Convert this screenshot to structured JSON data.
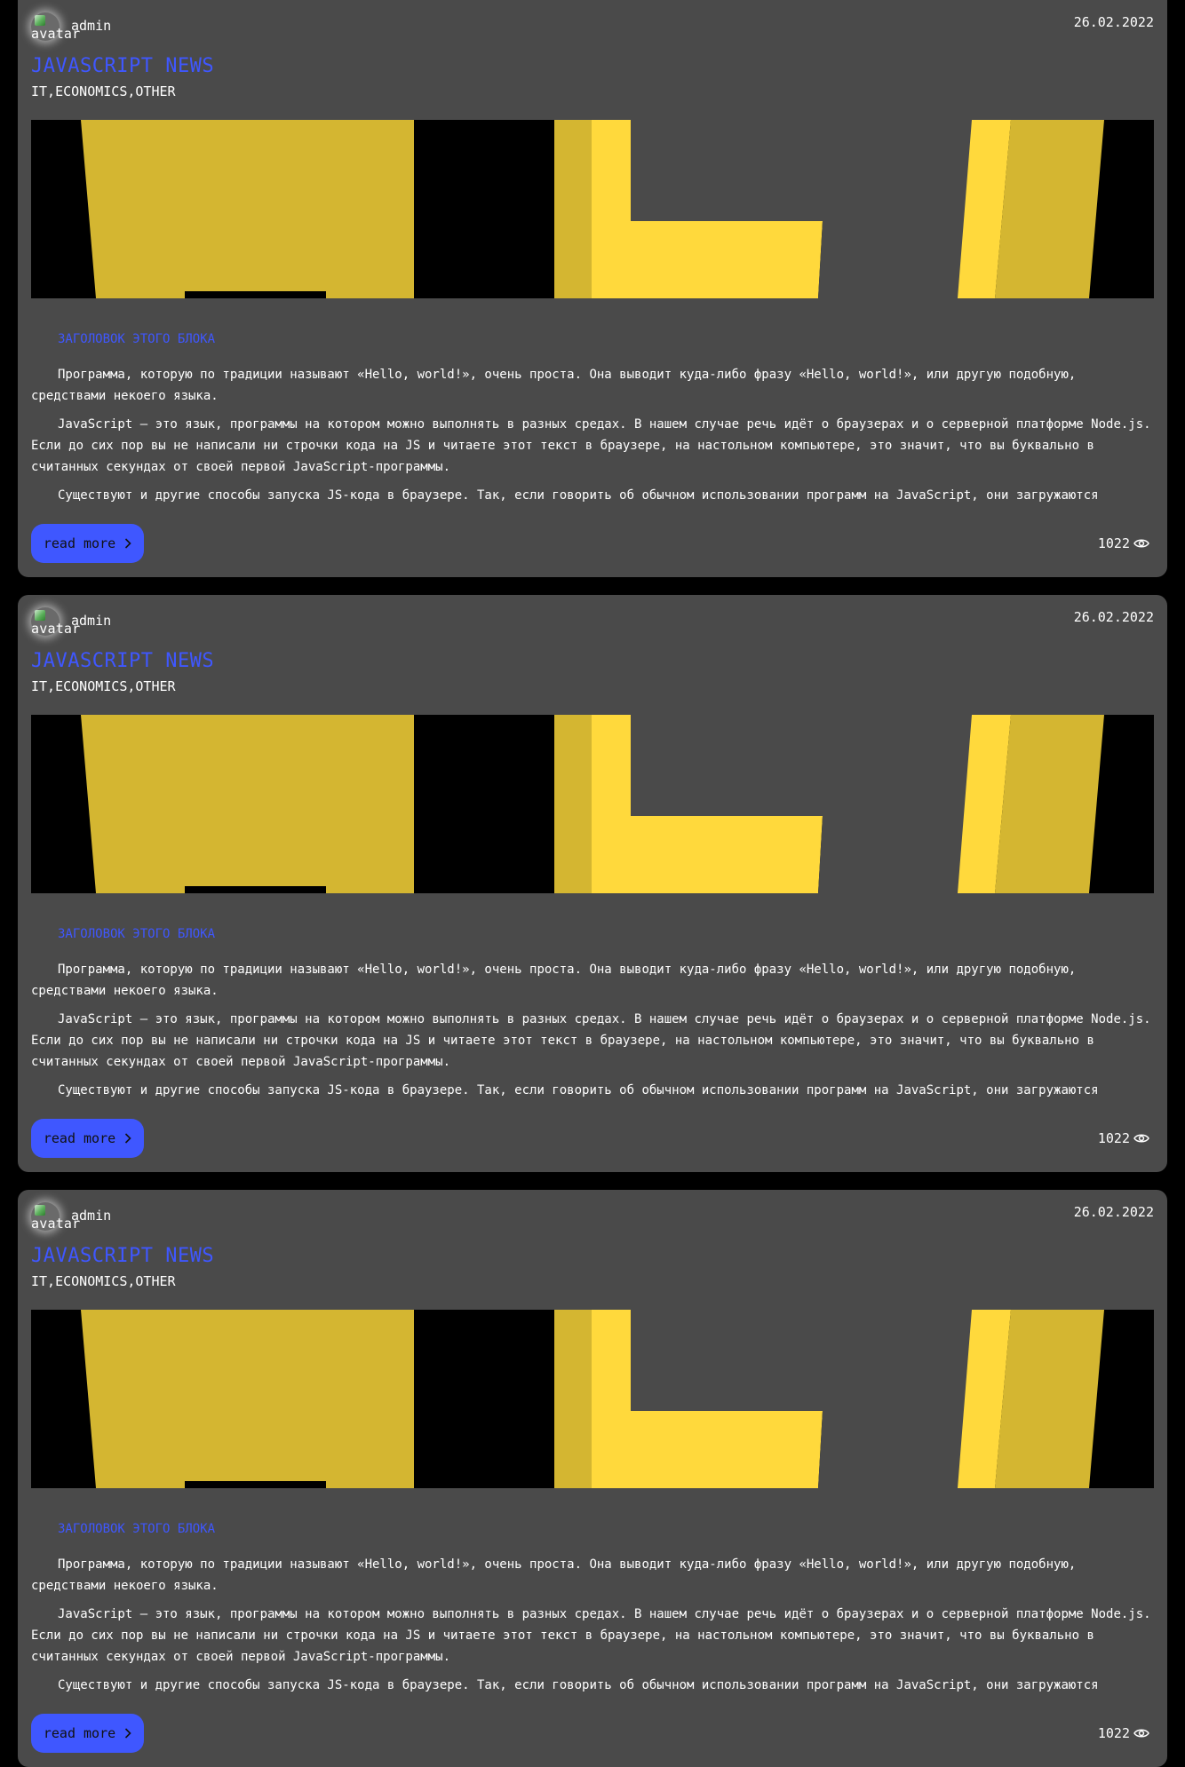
{
  "posts": [
    {
      "author": "admin",
      "avatar_alt": "avatar",
      "date": "26.02.2022",
      "title": "JAVASCRIPT NEWS",
      "tags": "IT,ECONOMICS,OTHER",
      "block_heading": "ЗАГОЛОВОК ЭТОГО БЛОКА",
      "paragraphs": [
        "Программа, которую по традиции называют «Hello, world!», очень проста. Она выводит куда-либо фразу «Hello, world!», или другую подобную, средствами некоего языка.",
        "JavaScript — это язык, программы на котором можно выполнять в разных средах. В нашем случае речь идёт о браузерах и о серверной платформе Node.js. Если до сих пор вы не написали ни строчки кода на JS и читаете этот текст в браузере, на настольном компьютере, это значит, что вы буквально в считанных секундах от своей первой JavaScript-программы.",
        "Существуют и другие способы запуска JS-кода в браузере. Так, если говорить об обычном использовании программ на JavaScript, они загружаются"
      ],
      "read_more_label": "read more",
      "views": "1022"
    },
    {
      "author": "admin",
      "avatar_alt": "avatar",
      "date": "26.02.2022",
      "title": "JAVASCRIPT NEWS",
      "tags": "IT,ECONOMICS,OTHER",
      "block_heading": "ЗАГОЛОВОК ЭТОГО БЛОКА",
      "paragraphs": [
        "Программа, которую по традиции называют «Hello, world!», очень проста. Она выводит куда-либо фразу «Hello, world!», или другую подобную, средствами некоего языка.",
        "JavaScript — это язык, программы на котором можно выполнять в разных средах. В нашем случае речь идёт о браузерах и о серверной платформе Node.js. Если до сих пор вы не написали ни строчки кода на JS и читаете этот текст в браузере, на настольном компьютере, это значит, что вы буквально в считанных секундах от своей первой JavaScript-программы.",
        "Существуют и другие способы запуска JS-кода в браузере. Так, если говорить об обычном использовании программ на JavaScript, они загружаются"
      ],
      "read_more_label": "read more",
      "views": "1022"
    },
    {
      "author": "admin",
      "avatar_alt": "avatar",
      "date": "26.02.2022",
      "title": "JAVASCRIPT NEWS",
      "tags": "IT,ECONOMICS,OTHER",
      "block_heading": "ЗАГОЛОВОК ЭТОГО БЛОКА",
      "paragraphs": [
        "Программа, которую по традиции называют «Hello, world!», очень проста. Она выводит куда-либо фразу «Hello, world!», или другую подобную, средствами некоего языка.",
        "JavaScript — это язык, программы на котором можно выполнять в разных средах. В нашем случае речь идёт о браузерах и о серверной платформе Node.js. Если до сих пор вы не написали ни строчки кода на JS и читаете этот текст в браузере, на настольном компьютере, это значит, что вы буквально в считанных секундах от своей первой JavaScript-программы.",
        "Существуют и другие способы запуска JS-кода в браузере. Так, если говорить об обычном использовании программ на JavaScript, они загружаются"
      ],
      "read_more_label": "read more",
      "views": "1022"
    }
  ],
  "icons": {
    "read_more": "chevron-right-icon",
    "views": "eye-icon",
    "avatar": "broken-image-icon"
  },
  "colors": {
    "page_background": "#000000",
    "card_background": "#4a4a4a",
    "accent": "#3f57ff",
    "banner_yellow": "#ffd93c",
    "banner_dark_yellow": "#d4b631"
  }
}
